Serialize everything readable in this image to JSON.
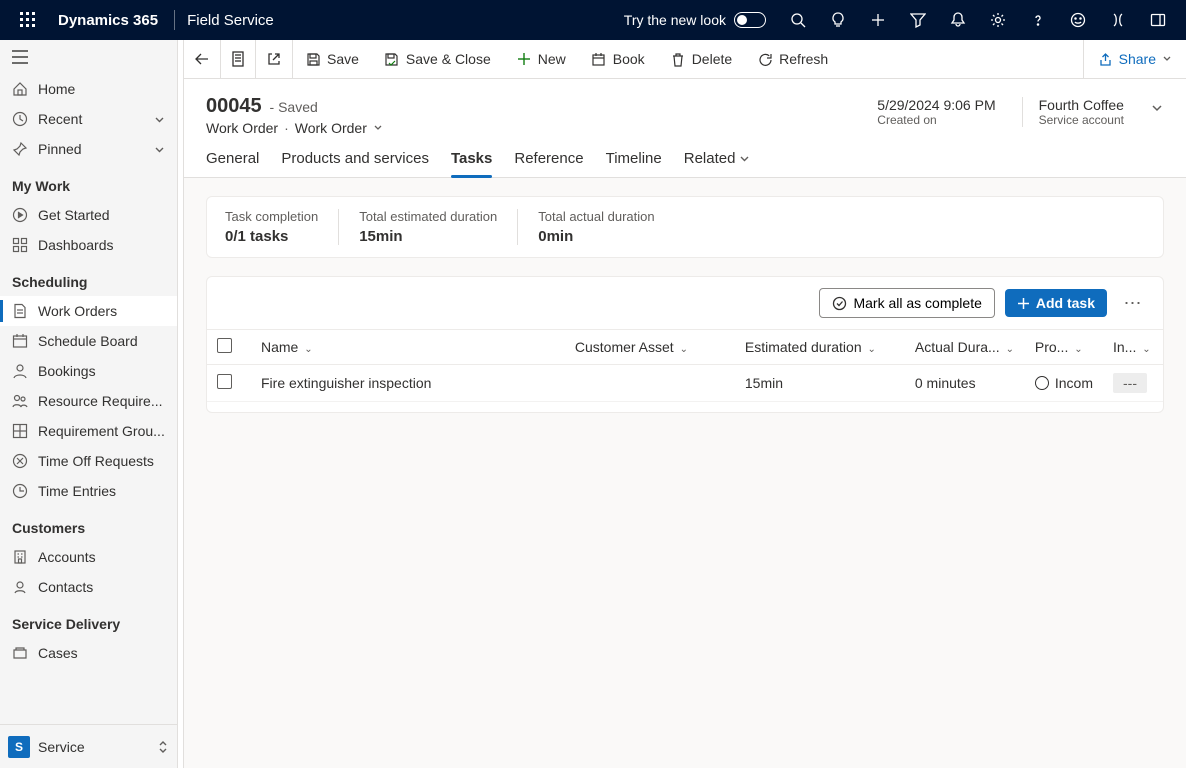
{
  "topbar": {
    "brand": "Dynamics 365",
    "app": "Field Service",
    "try_label": "Try the new look"
  },
  "leftnav": {
    "top_items": [
      {
        "icon": "home",
        "label": "Home"
      },
      {
        "icon": "clock",
        "label": "Recent",
        "expandable": true
      },
      {
        "icon": "pin",
        "label": "Pinned",
        "expandable": true
      }
    ],
    "groups": [
      {
        "title": "My Work",
        "items": [
          {
            "icon": "play",
            "label": "Get Started"
          },
          {
            "icon": "dashboard",
            "label": "Dashboards"
          }
        ]
      },
      {
        "title": "Scheduling",
        "items": [
          {
            "icon": "doc",
            "label": "Work Orders",
            "active": true
          },
          {
            "icon": "calendar",
            "label": "Schedule Board"
          },
          {
            "icon": "person",
            "label": "Bookings"
          },
          {
            "icon": "people",
            "label": "Resource Require..."
          },
          {
            "icon": "grid",
            "label": "Requirement Grou..."
          },
          {
            "icon": "timeoff",
            "label": "Time Off Requests"
          },
          {
            "icon": "time",
            "label": "Time Entries"
          }
        ]
      },
      {
        "title": "Customers",
        "items": [
          {
            "icon": "building",
            "label": "Accounts"
          },
          {
            "icon": "contact",
            "label": "Contacts"
          }
        ]
      },
      {
        "title": "Service Delivery",
        "items": [
          {
            "icon": "case",
            "label": "Cases"
          }
        ]
      }
    ],
    "area": {
      "badge": "S",
      "label": "Service"
    }
  },
  "cmdbar": {
    "save": "Save",
    "save_close": "Save & Close",
    "new": "New",
    "book": "Book",
    "delete": "Delete",
    "refresh": "Refresh",
    "share": "Share"
  },
  "record": {
    "title": "00045",
    "saved": "- Saved",
    "entity": "Work Order",
    "form": "Work Order",
    "meta": [
      {
        "value": "5/29/2024 9:06 PM",
        "label": "Created on"
      },
      {
        "value": "Fourth Coffee",
        "label": "Service account",
        "link": true
      }
    ]
  },
  "tabs": [
    "General",
    "Products and services",
    "Tasks",
    "Reference",
    "Timeline",
    "Related"
  ],
  "active_tab": "Tasks",
  "stats": [
    {
      "label": "Task completion",
      "value": "0/1 tasks"
    },
    {
      "label": "Total estimated duration",
      "value": "15min"
    },
    {
      "label": "Total actual duration",
      "value": "0min"
    }
  ],
  "grid": {
    "mark_all": "Mark all as complete",
    "add_task": "Add task",
    "columns": [
      "Name",
      "Customer Asset",
      "Estimated duration",
      "Actual Dura...",
      "Pro...",
      "In..."
    ],
    "rows": [
      {
        "name": "Fire extinguisher inspection",
        "customer_asset": "",
        "estimated_duration": "15min",
        "actual_duration": "0 minutes",
        "progress": "Incom",
        "inspection": "---"
      }
    ]
  }
}
